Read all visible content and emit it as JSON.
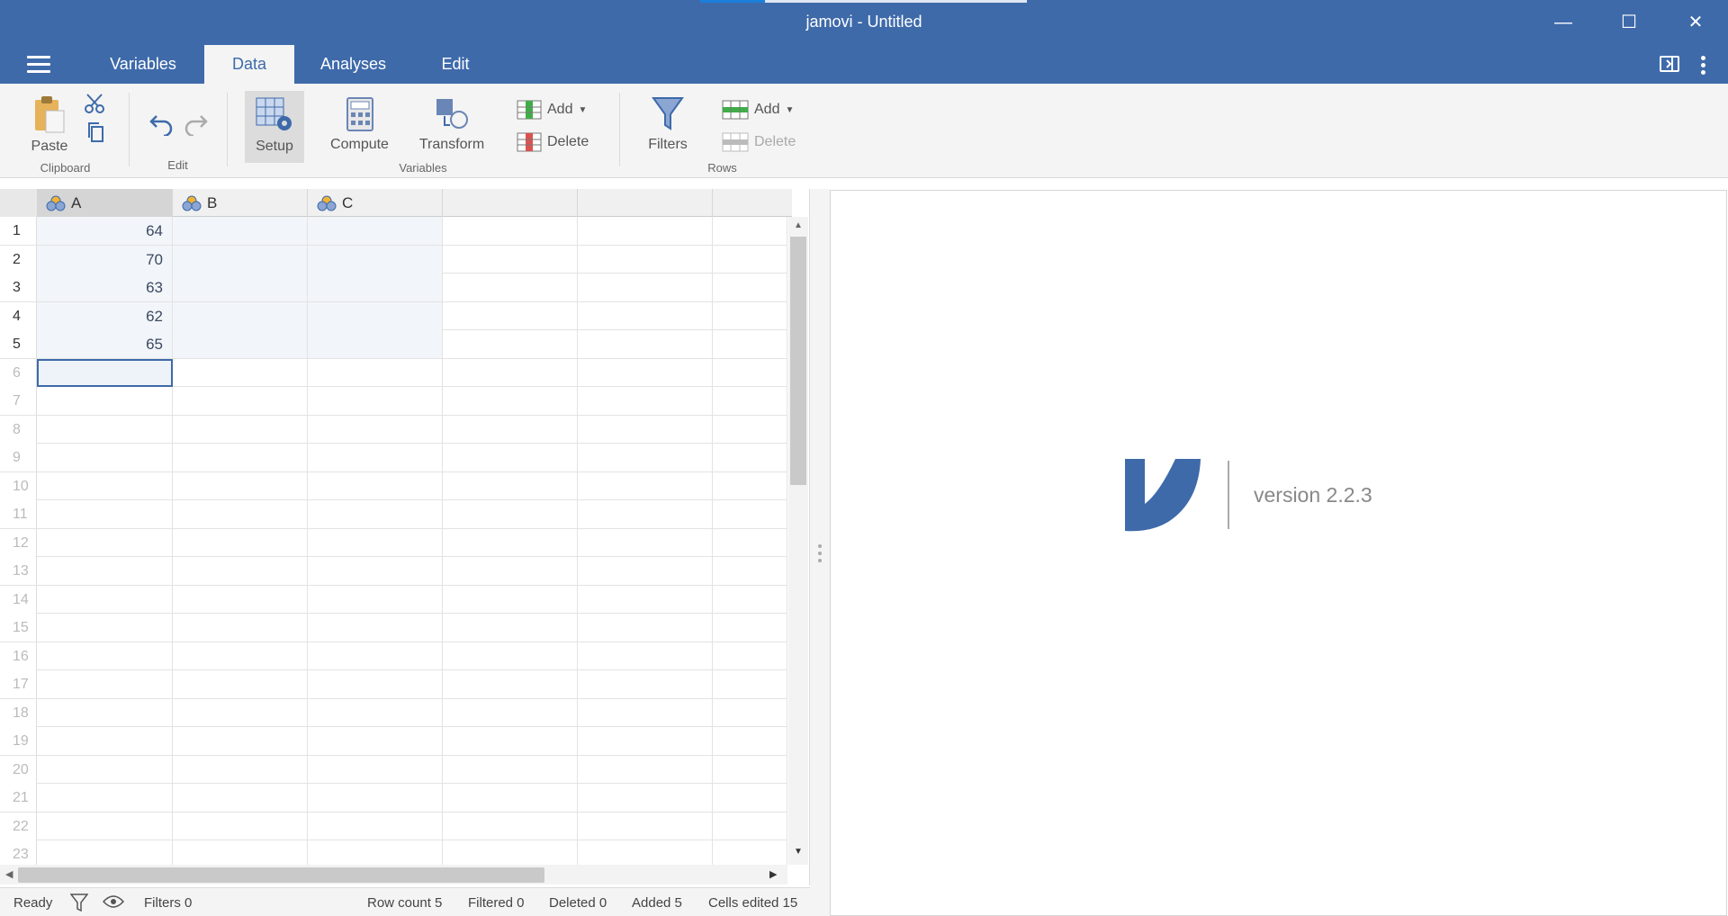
{
  "window": {
    "title": "jamovi - Untitled",
    "controls": [
      "minimize-icon",
      "maximize-icon",
      "close-icon"
    ]
  },
  "tabs": [
    {
      "label": "Variables",
      "active": false
    },
    {
      "label": "Data",
      "active": true
    },
    {
      "label": "Analyses",
      "active": false
    },
    {
      "label": "Edit",
      "active": false
    }
  ],
  "ribbon": {
    "clipboard": {
      "paste": "Paste",
      "group": "Clipboard"
    },
    "edit": {
      "group": "Edit"
    },
    "variables": {
      "setup": "Setup",
      "compute": "Compute",
      "transform": "Transform",
      "add": "Add",
      "delete": "Delete",
      "group": "Variables"
    },
    "rows": {
      "filters": "Filters",
      "add": "Add",
      "delete": "Delete",
      "group": "Rows"
    }
  },
  "spreadsheet": {
    "columns": [
      "A",
      "B",
      "C"
    ],
    "rows": [
      {
        "num": "1",
        "A": "64"
      },
      {
        "num": "2",
        "A": "70"
      },
      {
        "num": "3",
        "A": "63"
      },
      {
        "num": "4",
        "A": "62"
      },
      {
        "num": "5",
        "A": "65"
      },
      {
        "num": "6",
        "A": ""
      },
      {
        "num": "7"
      },
      {
        "num": "8"
      },
      {
        "num": "9"
      },
      {
        "num": "10"
      },
      {
        "num": "11"
      },
      {
        "num": "12"
      },
      {
        "num": "13"
      },
      {
        "num": "14"
      },
      {
        "num": "15"
      },
      {
        "num": "16"
      },
      {
        "num": "17"
      },
      {
        "num": "18"
      },
      {
        "num": "19"
      },
      {
        "num": "20"
      },
      {
        "num": "21"
      },
      {
        "num": "22"
      },
      {
        "num": "23"
      }
    ]
  },
  "status": {
    "ready": "Ready",
    "filters": "Filters 0",
    "row_count": "Row count 5",
    "filtered": "Filtered 0",
    "deleted": "Deleted 0",
    "added": "Added 5",
    "cells_edited": "Cells edited 15"
  },
  "results": {
    "version": "version 2.2.3"
  },
  "colors": {
    "brand": "#3e6aaa",
    "ribbon_bg": "#f4f4f4"
  }
}
